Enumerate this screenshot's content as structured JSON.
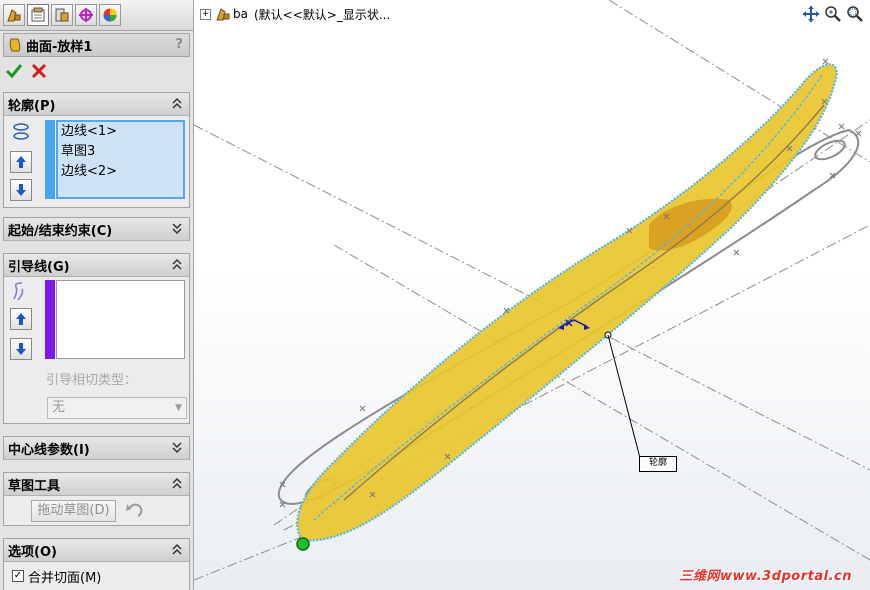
{
  "colors": {
    "selection_blue": "#4da4ee",
    "guide_purple": "#7b18f0",
    "surface_yellow": "#e9c52e",
    "edge_cyan": "#4fb6ea",
    "profile_gray": "#8a8a8a",
    "watermark_red": "#e8322b"
  },
  "tabs": [
    {
      "icon": "feature-manager-icon"
    },
    {
      "icon": "property-manager-icon"
    },
    {
      "icon": "configuration-manager-icon"
    },
    {
      "icon": "dimxpert-icon"
    },
    {
      "icon": "display-manager-icon"
    }
  ],
  "feature": {
    "title": "曲面-放样1",
    "help": "?"
  },
  "profiles": {
    "title": "轮廓(P)",
    "items": [
      "边线<1>",
      "草图3",
      "边线<2>"
    ]
  },
  "constraints": {
    "title": "起始/结束约束(C)"
  },
  "guides": {
    "title": "引导线(G)",
    "tangency_label": "引导相切类型：",
    "tangency_value": "无"
  },
  "centerline": {
    "title": "中心线参数(I)"
  },
  "sketch_tools": {
    "title": "草图工具",
    "drag_button": "拖动草图(D)"
  },
  "options": {
    "title": "选项(O)",
    "merge_tangent_faces": "合并切面(M)",
    "merge_checked": true
  },
  "tree": {
    "part_name": "ba",
    "config": "(默认<<默认>_显示状..."
  },
  "viewport": {
    "callout_label": "轮廓",
    "watermark": "三维网www.3dportal.cn"
  }
}
